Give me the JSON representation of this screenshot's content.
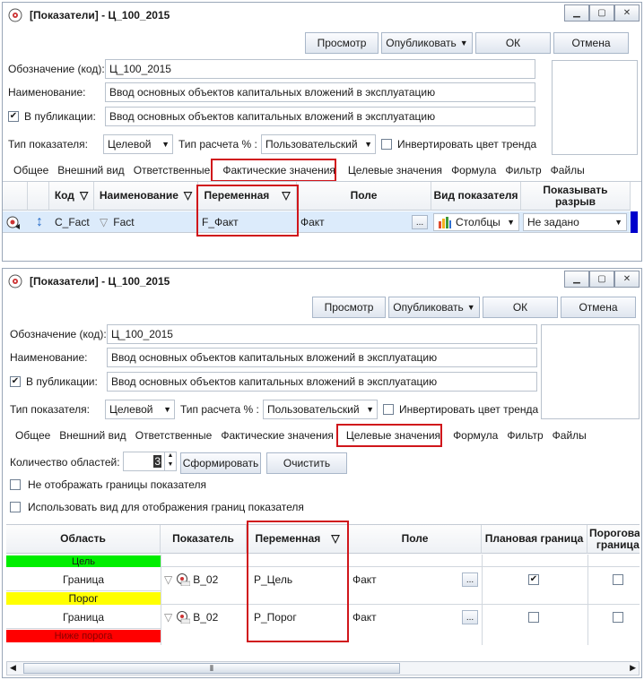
{
  "colors": {
    "accent_red": "#d0161b",
    "green": "#00ee00",
    "yellow": "#ffff00",
    "red": "#ff0000",
    "scroll_blue": "#0000cc"
  },
  "window1": {
    "title": "[Показатели] - Ц_100_2015",
    "toolbar": {
      "preview": "Просмотр",
      "publish": "Опубликовать",
      "ok": "ОК",
      "cancel": "Отмена"
    },
    "form": {
      "code_label": "Обозначение (код):",
      "code_value": "Ц_100_2015",
      "name_label": "Наименование:",
      "name_value": "Ввод основных объектов капитальных вложений в эксплуатацию",
      "pub_label": "В публикации:",
      "pub_value": "Ввод основных объектов капитальных вложений в эксплуатацию",
      "type_label": "Тип показателя:",
      "type_value": "Целевой",
      "calc_label": "Тип расчета % :",
      "calc_value": "Пользовательский",
      "invert_label": "Инвертировать цвет тренда"
    },
    "tabs": [
      "Общее",
      "Внешний вид",
      "Ответственные",
      "Фактические значения",
      "Целевые значения",
      "Формула",
      "Фильтр",
      "Файлы"
    ],
    "grid": {
      "headers": {
        "code": "Код",
        "name": "Наименование",
        "variable": "Переменная",
        "field": "Поле",
        "view": "Вид показателя",
        "gap": "Показывать разрыв"
      },
      "row": {
        "code": "C_Fact",
        "name": "Fact",
        "variable": "F_Факт",
        "field": "Факт",
        "view": "Столбцы",
        "gap": "Не задано"
      }
    }
  },
  "window2": {
    "title": "[Показатели] - Ц_100_2015",
    "toolbar": {
      "preview": "Просмотр",
      "publish": "Опубликовать",
      "ok": "ОК",
      "cancel": "Отмена"
    },
    "form": {
      "code_label": "Обозначение (код):",
      "code_value": "Ц_100_2015",
      "name_label": "Наименование:",
      "name_value": "Ввод основных объектов капитальных вложений в эксплуатацию",
      "pub_label": "В публикации:",
      "pub_value": "Ввод основных объектов капитальных вложений в эксплуатацию",
      "type_label": "Тип показателя:",
      "type_value": "Целевой",
      "calc_label": "Тип расчета % :",
      "calc_value": "Пользовательский",
      "invert_label": "Инвертировать цвет тренда"
    },
    "tabs": [
      "Общее",
      "Внешний вид",
      "Ответственные",
      "Фактические значения",
      "Целевые значения",
      "Формула",
      "Фильтр",
      "Файлы"
    ],
    "areas": {
      "count_label": "Количество областей:",
      "count_value": "3",
      "build": "Сформировать",
      "clear": "Очистить",
      "no_borders": "Не отображать границы показателя",
      "use_view": "Использовать вид для отображения границ показателя"
    },
    "grid": {
      "headers": {
        "area": "Область",
        "indicator": "Показатель",
        "variable": "Переменная",
        "field": "Поле",
        "plan": "Плановая граница",
        "threshold": "Пороговая граница"
      },
      "rows": [
        {
          "area": "Цель",
          "kind": "band"
        },
        {
          "area": "Граница",
          "indicator": "B_02",
          "variable": "P_Цель",
          "field": "Факт",
          "plan": true,
          "threshold": false,
          "kind": "border"
        },
        {
          "area": "Порог",
          "kind": "band"
        },
        {
          "area": "Граница",
          "indicator": "B_02",
          "variable": "P_Порог",
          "field": "Факт",
          "plan": false,
          "threshold": false,
          "kind": "border"
        },
        {
          "area": "Ниже порога",
          "kind": "band"
        }
      ]
    }
  }
}
